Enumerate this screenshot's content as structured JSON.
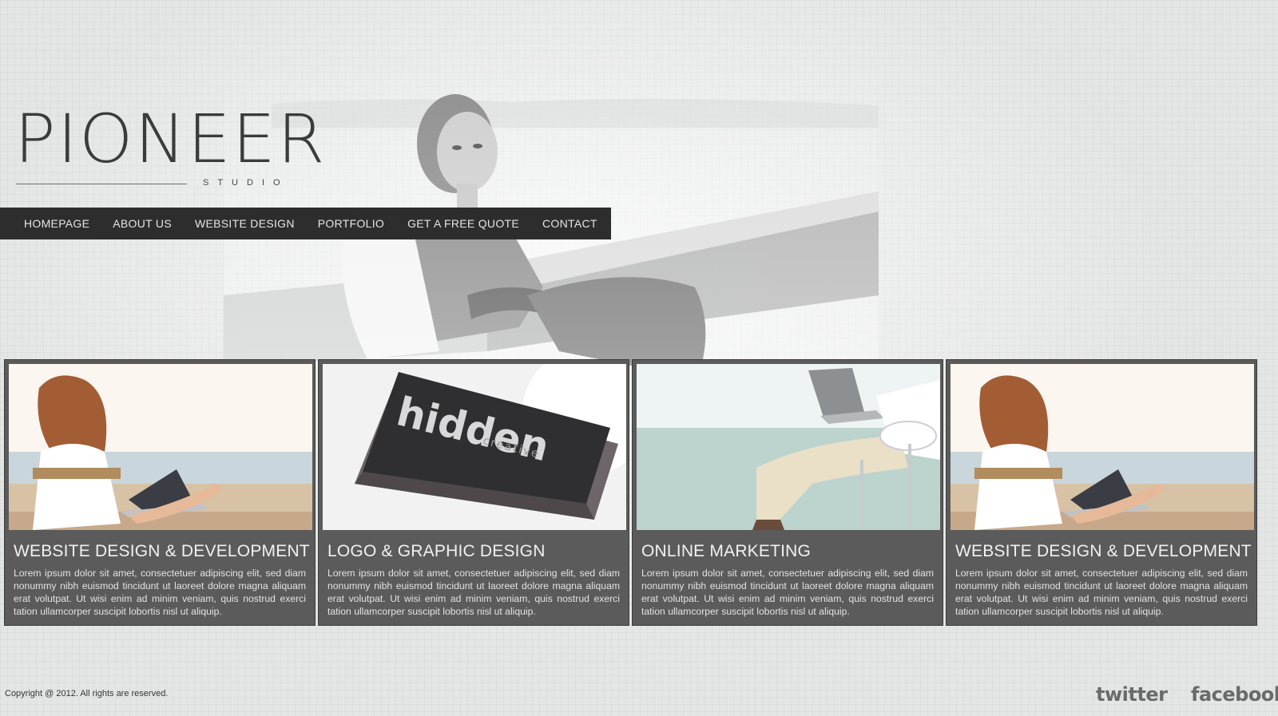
{
  "logo": {
    "word": "PIONEER",
    "sub": "STUDIO"
  },
  "nav": {
    "items": [
      {
        "label": "HOMEPAGE"
      },
      {
        "label": "ABOUT US"
      },
      {
        "label": "WEBSITE DESIGN"
      },
      {
        "label": "PORTFOLIO"
      },
      {
        "label": "GET A FREE QUOTE"
      },
      {
        "label": "CONTACT"
      }
    ]
  },
  "cards": [
    {
      "title": "WEBSITE DESIGN & DEVELOPMENT",
      "text": "Lorem ipsum dolor sit amet, consectetuer adipiscing elit, sed diam nonummy nibh euismod tincidunt ut laoreet dolore magna aliquam erat volutpat. Ut wisi enim ad minim veniam, quis nostrud exerci tation ullamcorper suscipit lobortis nisl ut aliquip."
    },
    {
      "title": "LOGO & GRAPHIC DESIGN",
      "text": "Lorem ipsum dolor sit amet, consectetuer adipiscing elit, sed diam nonummy nibh euismod tincidunt ut laoreet dolore magna aliquam erat volutpat. Ut wisi enim ad minim veniam, quis nostrud exerci tation ullamcorper suscipit lobortis nisl ut aliquip.",
      "card_brand": "hidden",
      "card_brand_sub": "creative"
    },
    {
      "title": "ONLINE MARKETING",
      "text": "Lorem ipsum dolor sit amet, consectetuer adipiscing elit, sed diam nonummy nibh euismod tincidunt ut laoreet dolore magna aliquam erat volutpat. Ut wisi enim ad minim veniam, quis nostrud exerci tation ullamcorper suscipit lobortis nisl ut aliquip."
    },
    {
      "title": "WEBSITE DESIGN & DEVELOPMENT",
      "text": "Lorem ipsum dolor sit amet, consectetuer adipiscing elit, sed diam nonummy nibh euismod tincidunt ut laoreet dolore magna aliquam erat volutpat. Ut wisi enim ad minim veniam, quis nostrud exerci tation ullamcorper suscipit lobortis nisl ut aliquip."
    }
  ],
  "footer": {
    "copyright": "Copyright @ 2012. All rights are reserved.",
    "twitter": "twitter",
    "facebook": "facebook"
  }
}
